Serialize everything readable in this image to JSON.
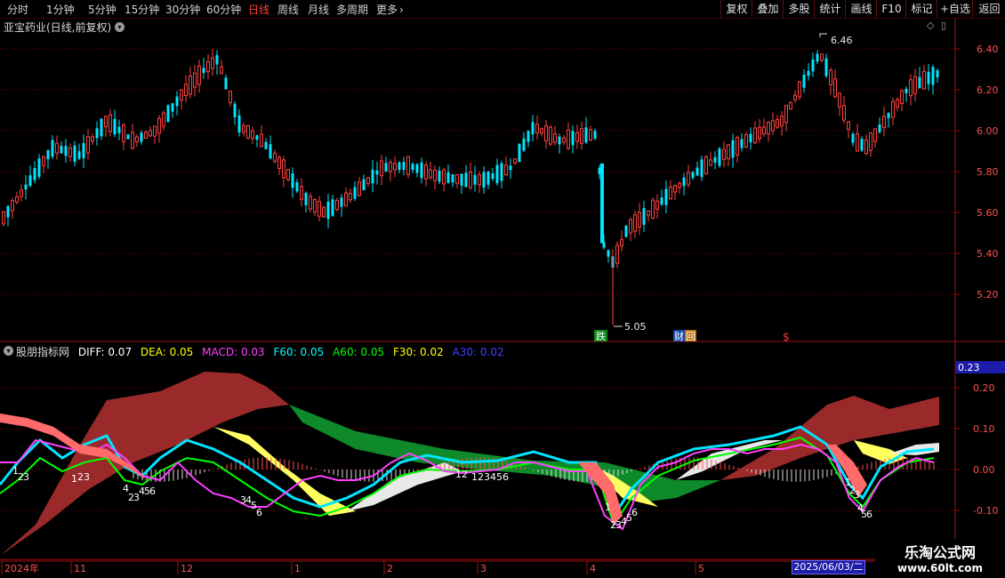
{
  "toolbar": {
    "periods": [
      "分时",
      "1分钟",
      "5分钟",
      "15分钟",
      "30分钟",
      "60分钟",
      "日线",
      "周线",
      "月线",
      "多周期",
      "更多"
    ],
    "active": "日线",
    "right_buttons": [
      "复权",
      "叠加",
      "多股",
      "统计",
      "画线",
      "F10",
      "+自选",
      "返回"
    ],
    "more_icon": "chevron-right-icon"
  },
  "main_chart": {
    "title": "亚宝药业(日线,前复权)",
    "y_ticks": [
      "6.40",
      "6.20",
      "6.00",
      "5.80",
      "5.60",
      "5.40",
      "5.20"
    ],
    "high_label": "6.46",
    "low_label": "5.05",
    "event_labels": [
      "跌",
      "财",
      "回",
      "$"
    ]
  },
  "indicator": {
    "name": "股朋指标网",
    "legend": [
      {
        "label": "DIFF: 0.07",
        "color": "#ffffff"
      },
      {
        "label": "DEA: 0.05",
        "color": "#ffff00"
      },
      {
        "label": "MACD: 0.03",
        "color": "#ff40ff"
      },
      {
        "label": "F60: 0.05",
        "color": "#00ffff"
      },
      {
        "label": "A60: 0.05",
        "color": "#00ff00"
      },
      {
        "label": "F30: 0.02",
        "color": "#ffff00"
      },
      {
        "label": "A30: 0.02",
        "color": "#4040ff"
      }
    ],
    "current_value": "0.23",
    "y_ticks": [
      "0.20",
      "0.10",
      "0.00",
      "-0.10"
    ],
    "sequence_labels": [
      "1",
      "2",
      "3",
      "1",
      "2",
      "3",
      "4",
      "2",
      "3",
      "4",
      "5",
      "6",
      "3",
      "4",
      "5",
      "6",
      "12",
      "123456",
      "1",
      "2",
      "3",
      "4",
      "5",
      "6",
      "1",
      "2",
      "3",
      "4",
      "5",
      "6"
    ]
  },
  "time_axis": {
    "labels": [
      "2024年",
      "11",
      "12",
      "1",
      "2",
      "3",
      "4",
      "5"
    ],
    "current_date": "2025/06/03/二"
  },
  "watermark": {
    "title": "乐淘公式网",
    "url": "www.60lt.com"
  },
  "colors": {
    "up": "#ff4040",
    "down": "#00e5ff",
    "grid": "#8b0000",
    "frame": "#a01010"
  }
}
